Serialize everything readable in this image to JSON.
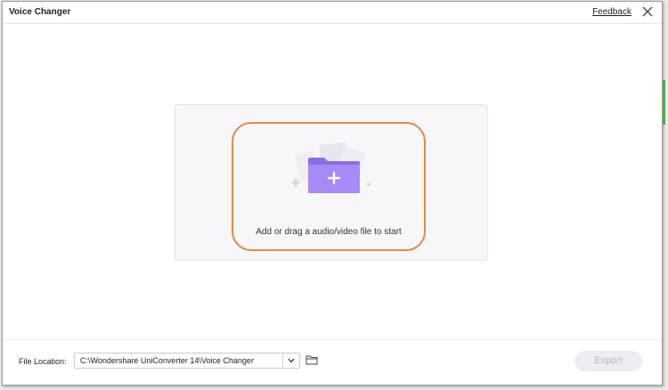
{
  "window": {
    "title": "Voice Changer",
    "feedback_label": "Feedback"
  },
  "drop_zone": {
    "prompt": "Add or drag a audio/video file to start"
  },
  "footer": {
    "file_location_label": "File Location:",
    "file_location_value": "C:\\Wondershare UniConverter 14\\Voice Changer",
    "export_label": "Export"
  },
  "colors": {
    "accent_orange": "#e28a43",
    "folder_purple": "#9b7ef0",
    "disabled_button": "#ecedf3"
  },
  "icons": {
    "close": "close-icon",
    "add_folder": "add-folder-icon",
    "dropdown": "chevron-down-icon",
    "browse": "folder-icon"
  }
}
